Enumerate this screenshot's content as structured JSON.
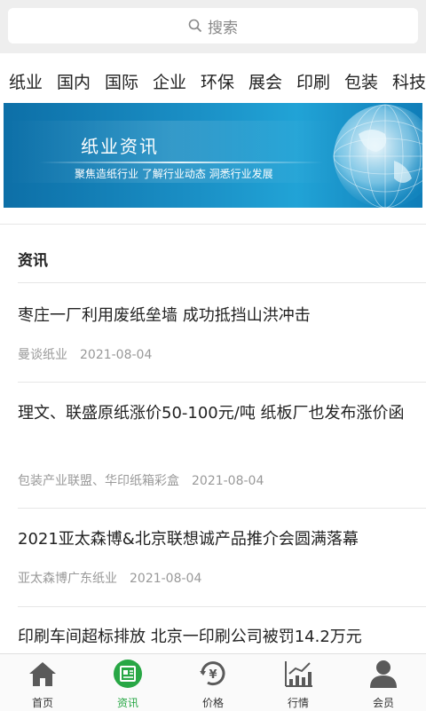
{
  "search": {
    "placeholder": "搜索",
    "icon": "search-icon"
  },
  "categories": [
    "纸业",
    "国内",
    "国际",
    "企业",
    "环保",
    "展会",
    "印刷",
    "包装",
    "科技"
  ],
  "banner": {
    "title": "纸业资讯",
    "subtitle": "聚焦造纸行业  了解行业动态  洞悉行业发展"
  },
  "section": {
    "title": "资讯"
  },
  "news": [
    {
      "title": "枣庄一厂利用废纸垒墙 成功抵挡山洪冲击",
      "source": "曼谈纸业",
      "date": "2021-08-04"
    },
    {
      "title": "理文、联盛原纸涨价50-100元/吨 纸板厂也发布涨价函",
      "source": "包装产业联盟、华印纸箱彩盒",
      "date": "2021-08-04"
    },
    {
      "title": "2021亚太森博&北京联想诚产品推介会圆满落幕",
      "source": "亚太森博广东纸业",
      "date": "2021-08-04"
    },
    {
      "title": "印刷车间超标排放 北京一印刷公司被罚14.2万元",
      "source": "",
      "date": ""
    }
  ],
  "tabs": [
    {
      "label": "首页",
      "icon": "home-icon",
      "active": false
    },
    {
      "label": "资讯",
      "icon": "news-icon",
      "active": true
    },
    {
      "label": "价格",
      "icon": "price-icon",
      "active": false
    },
    {
      "label": "行情",
      "icon": "chart-icon",
      "active": false
    },
    {
      "label": "会员",
      "icon": "member-icon",
      "active": false
    }
  ],
  "colors": {
    "accent": "#28a745",
    "topbar": "#eeeeee",
    "banner": "#1a8fc5"
  }
}
